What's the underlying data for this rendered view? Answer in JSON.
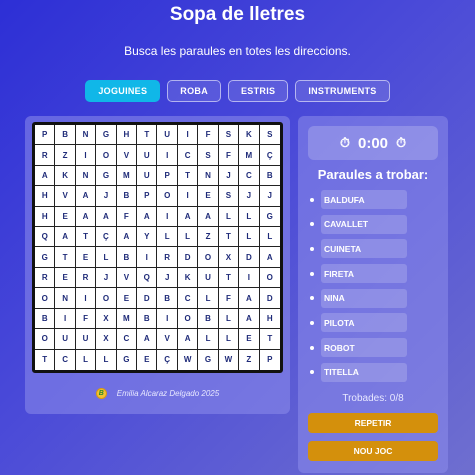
{
  "header": {
    "title": "Sopa de lletres",
    "subtitle": "Busca les paraules en totes les direccions."
  },
  "tabs": [
    {
      "label": "JOGUINES",
      "active": true
    },
    {
      "label": "ROBA",
      "active": false
    },
    {
      "label": "ESTRIS",
      "active": false
    },
    {
      "label": "INSTRUMENTS",
      "active": false
    }
  ],
  "grid": [
    [
      "P",
      "B",
      "N",
      "G",
      "H",
      "T",
      "U",
      "I",
      "F",
      "S",
      "K",
      "S"
    ],
    [
      "R",
      "Z",
      "I",
      "O",
      "V",
      "U",
      "I",
      "C",
      "S",
      "F",
      "M",
      "Ç"
    ],
    [
      "A",
      "K",
      "N",
      "G",
      "M",
      "U",
      "P",
      "T",
      "N",
      "J",
      "C",
      "B"
    ],
    [
      "H",
      "V",
      "A",
      "J",
      "B",
      "P",
      "O",
      "I",
      "E",
      "S",
      "J",
      "J"
    ],
    [
      "H",
      "E",
      "A",
      "A",
      "F",
      "A",
      "I",
      "A",
      "A",
      "L",
      "L",
      "G"
    ],
    [
      "Q",
      "A",
      "T",
      "Ç",
      "A",
      "Y",
      "L",
      "L",
      "Z",
      "T",
      "L",
      "L"
    ],
    [
      "G",
      "T",
      "E",
      "L",
      "B",
      "I",
      "R",
      "D",
      "O",
      "X",
      "D",
      "A"
    ],
    [
      "R",
      "E",
      "R",
      "J",
      "V",
      "Q",
      "J",
      "K",
      "U",
      "T",
      "I",
      "O"
    ],
    [
      "O",
      "N",
      "I",
      "O",
      "E",
      "D",
      "B",
      "C",
      "L",
      "F",
      "A",
      "D"
    ],
    [
      "B",
      "I",
      "F",
      "X",
      "M",
      "B",
      "I",
      "O",
      "B",
      "L",
      "A",
      "H"
    ],
    [
      "O",
      "U",
      "U",
      "X",
      "C",
      "A",
      "V",
      "A",
      "L",
      "L",
      "E",
      "T"
    ],
    [
      "T",
      "C",
      "L",
      "L",
      "G",
      "E",
      "Ç",
      "W",
      "G",
      "W",
      "Z",
      "P"
    ]
  ],
  "footer": {
    "credit": "Emilia Alcaraz Delgado 2025"
  },
  "timer": {
    "value": "0:00",
    "icon_left": "stopwatch-icon",
    "icon_right": "stopwatch-icon"
  },
  "words": {
    "title": "Paraules a trobar:",
    "items": [
      "BALDUFA",
      "CAVALLET",
      "CUINETA",
      "FIRETA",
      "NINA",
      "PILOTA",
      "ROBOT",
      "TITELLA"
    ]
  },
  "status": {
    "found": "Trobades: 0/8"
  },
  "buttons": {
    "repeat": "REPETIR",
    "new_game": "NOU JOC"
  },
  "colors": {
    "accent_tab": "#10b7e8",
    "button": "#d4900c",
    "grid_text": "#1e2a78"
  }
}
